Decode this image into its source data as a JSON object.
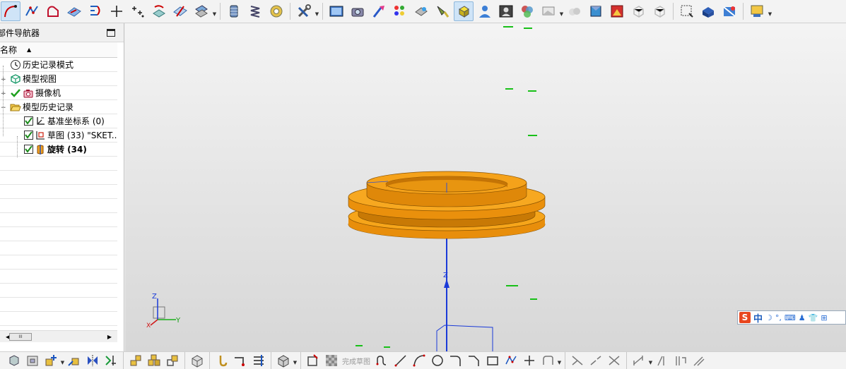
{
  "navigator": {
    "title": "部件导航器",
    "column_name": "名称",
    "items": [
      {
        "label": "历史记录模式",
        "icon": "clock-icon"
      },
      {
        "label": "模型视图",
        "icon": "model-view-icon"
      },
      {
        "label": "摄像机",
        "icon": "camera-icon"
      },
      {
        "label": "模型历史记录",
        "icon": "folder-open-icon"
      },
      {
        "label": "基准坐标系 (0)",
        "icon": "datum-csys-icon"
      },
      {
        "label": "草图 (33) \"SKET...",
        "icon": "sketch-icon"
      },
      {
        "label": "旋转 (34)",
        "icon": "revolve-icon"
      }
    ],
    "scroll_thumb": "III"
  },
  "viewport": {
    "axis_z_label": "Z",
    "triad": {
      "z": "Z",
      "y": "Y",
      "x": "X"
    },
    "model_color": "#f29b0c"
  },
  "ime": {
    "logo": "S",
    "mode": "中",
    "glyphs": [
      "☽",
      "°,",
      "⌨",
      "♟",
      "👕",
      "⊞"
    ]
  },
  "bottom_toolbar": {
    "finish_sketch_label": "完成草图"
  }
}
